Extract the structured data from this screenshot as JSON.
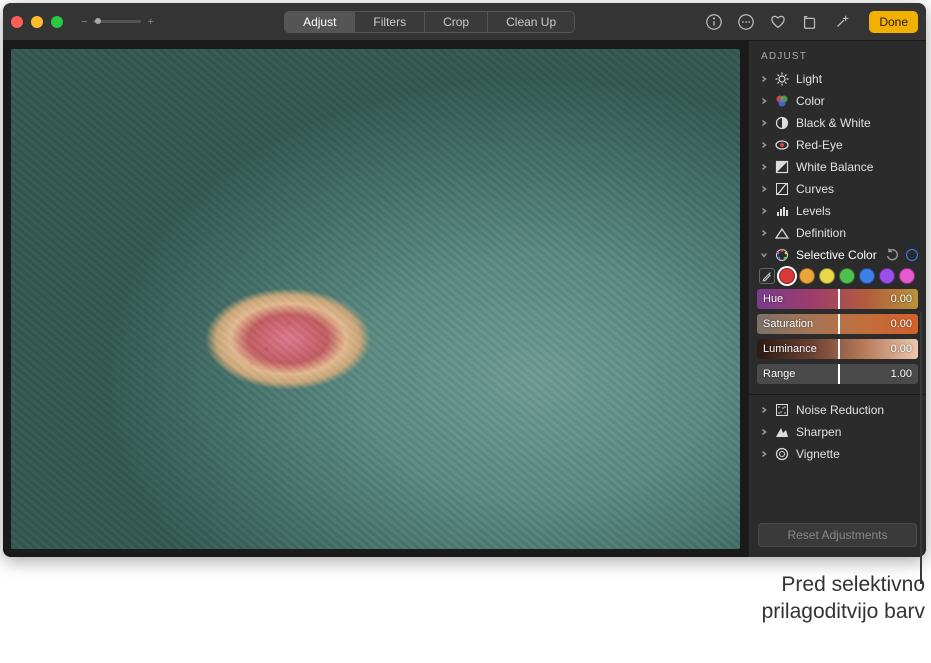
{
  "titlebar": {
    "tabs": {
      "adjust": "Adjust",
      "filters": "Filters",
      "crop": "Crop",
      "cleanup": "Clean Up"
    },
    "done": "Done"
  },
  "sidebar": {
    "title": "ADJUST",
    "rows": {
      "light": "Light",
      "color": "Color",
      "bw": "Black & White",
      "redeye": "Red-Eye",
      "wb": "White Balance",
      "curves": "Curves",
      "levels": "Levels",
      "definition": "Definition",
      "selective": "Selective Color",
      "noise": "Noise Reduction",
      "sharpen": "Sharpen",
      "vignette": "Vignette"
    },
    "selective": {
      "swatches": [
        "#d83a3a",
        "#eba53a",
        "#e8d94a",
        "#4fbf4f",
        "#3f7fe8",
        "#9a4fe8",
        "#e85ad1"
      ],
      "sliders": {
        "hue": {
          "label": "Hue",
          "value": "0.00",
          "pos": 50
        },
        "saturation": {
          "label": "Saturation",
          "value": "0.00",
          "pos": 50
        },
        "luminance": {
          "label": "Luminance",
          "value": "0.00",
          "pos": 50
        },
        "range": {
          "label": "Range",
          "value": "1.00",
          "pos": 50
        }
      }
    },
    "reset": "Reset Adjustments"
  },
  "caption": {
    "line1": "Pred selektivno",
    "line2": "prilagoditvijo barv"
  }
}
